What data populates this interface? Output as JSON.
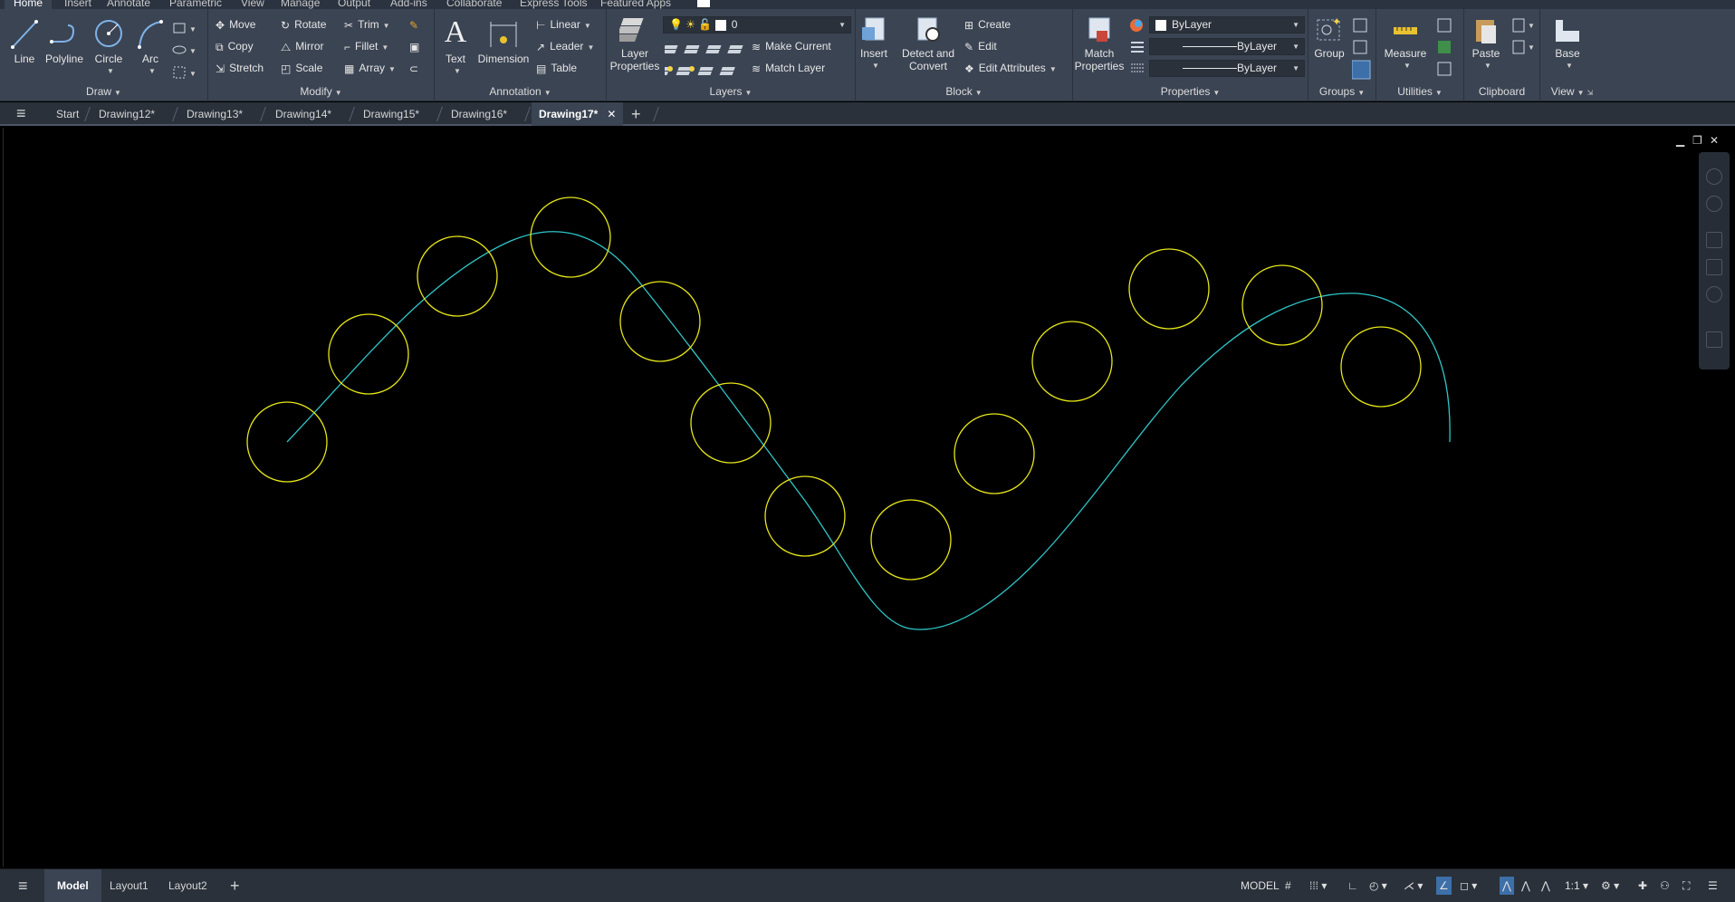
{
  "menu": {
    "tabs": [
      "Home",
      "Insert",
      "Annotate",
      "Parametric",
      "View",
      "Manage",
      "Output",
      "Add-ins",
      "Collaborate",
      "Express Tools",
      "Featured Apps"
    ],
    "active": "Home"
  },
  "ribbon": {
    "draw": {
      "title": "Draw",
      "line": "Line",
      "polyline": "Polyline",
      "circle": "Circle",
      "arc": "Arc"
    },
    "modify": {
      "title": "Modify",
      "move": "Move",
      "rotate": "Rotate",
      "trim": "Trim",
      "copy": "Copy",
      "mirror": "Mirror",
      "fillet": "Fillet",
      "stretch": "Stretch",
      "scale": "Scale",
      "array": "Array"
    },
    "annotation": {
      "title": "Annotation",
      "text": "Text",
      "dimension": "Dimension",
      "linear": "Linear",
      "leader": "Leader",
      "table": "Table"
    },
    "layers": {
      "title": "Layers",
      "layer_properties": "Layer Properties",
      "current_layer": "0",
      "make_current": "Make Current",
      "match_layer": "Match Layer"
    },
    "block": {
      "title": "Block",
      "insert": "Insert",
      "detect_convert": "Detect and Convert",
      "create": "Create",
      "edit": "Edit",
      "edit_attributes": "Edit Attributes"
    },
    "properties": {
      "title": "Properties",
      "match_properties": "Match Properties",
      "color": "ByLayer",
      "linetype": "ByLayer",
      "lineweight": "ByLayer"
    },
    "groups": {
      "title": "Groups",
      "group": "Group"
    },
    "utilities": {
      "title": "Utilities",
      "measure": "Measure"
    },
    "clipboard": {
      "title": "Clipboard",
      "paste": "Paste"
    },
    "view": {
      "title": "View",
      "base": "Base"
    }
  },
  "file_tabs": {
    "start": "Start",
    "drawings": [
      "Drawing12*",
      "Drawing13*",
      "Drawing14*",
      "Drawing15*",
      "Drawing16*"
    ],
    "active": "Drawing17*"
  },
  "layout_tabs": {
    "active": "Model",
    "others": [
      "Layout1",
      "Layout2"
    ]
  },
  "status": {
    "model": "MODEL",
    "scale": "1:1"
  },
  "colors": {
    "spline": "#2fc6c8",
    "circles": "#e6e619",
    "ribbon_bg": "#3b4453",
    "tab_bg": "#2a313b"
  }
}
